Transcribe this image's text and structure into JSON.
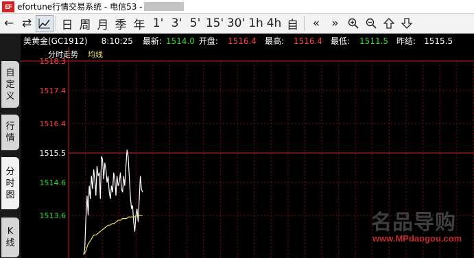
{
  "titlebar": {
    "logo_text": "EF",
    "title": "efortune行情交易系统 - 电信53 - "
  },
  "toolbar": {
    "buttons": [
      {
        "name": "back-arrow-icon",
        "glyph": "←"
      },
      {
        "name": "kline-toggle-icon",
        "glyph": "⇄"
      },
      {
        "name": "line-chart-icon",
        "glyph": "",
        "active": true
      },
      {
        "name": "period-day",
        "glyph": "日"
      },
      {
        "name": "period-week",
        "glyph": "周"
      },
      {
        "name": "period-month",
        "glyph": "月"
      },
      {
        "name": "period-season",
        "glyph": "季"
      },
      {
        "name": "period-year",
        "glyph": "年"
      },
      {
        "name": "period-1min",
        "glyph": "1'"
      },
      {
        "name": "period-3min",
        "glyph": "3'"
      },
      {
        "name": "period-5min",
        "glyph": "5'"
      },
      {
        "name": "period-15min",
        "glyph": "15'"
      },
      {
        "name": "period-30min",
        "glyph": "30'"
      },
      {
        "name": "period-1h",
        "glyph": "1h"
      },
      {
        "name": "period-4h",
        "glyph": "4h"
      },
      {
        "name": "period-custom",
        "glyph": "自"
      },
      {
        "name": "double-left-icon",
        "glyph": "«"
      },
      {
        "name": "double-right-icon",
        "glyph": "»"
      },
      {
        "name": "zoom-in-icon",
        "glyph": ""
      },
      {
        "name": "zoom-out-icon",
        "glyph": ""
      },
      {
        "name": "up-house-icon",
        "glyph": ""
      },
      {
        "name": "down-house-icon",
        "glyph": ""
      }
    ]
  },
  "infobar": {
    "symbol": "美黄金(GC1912)",
    "time": "8:10:25",
    "latest_label": "最新:",
    "latest_value": "1514.0",
    "open_label": "开盘:",
    "open_value": "1516.4",
    "high_label": "最高:",
    "high_value": "1516.4",
    "low_label": "最低:",
    "low_value": "1511.5",
    "prev_label": "昨结:",
    "prev_value": "1515.5"
  },
  "tabs": [
    {
      "label": "自定义",
      "chars": [
        "自",
        "定",
        "义"
      ]
    },
    {
      "label": "行情",
      "chars": [
        "行",
        "情"
      ]
    },
    {
      "label": "分时图",
      "chars": [
        "分",
        "时",
        "图"
      ]
    },
    {
      "label": "K线",
      "chars": [
        "K",
        "线"
      ]
    }
  ],
  "chart_data": {
    "type": "line",
    "title": "分时走势",
    "legend": [
      "均线"
    ],
    "ylim": [
      1512.3,
      1518.3
    ],
    "yticks": [
      {
        "value": 1518.3,
        "label": "1518.3",
        "color": "#ff4040"
      },
      {
        "value": 1517.4,
        "label": "1517.4",
        "color": "#ff4040"
      },
      {
        "value": 1516.4,
        "label": "1516.4",
        "color": "#ff4040"
      },
      {
        "value": 1515.5,
        "label": "1515.5",
        "color": "#ffffff"
      },
      {
        "value": 1514.6,
        "label": "1514.6",
        "color": "#31d931"
      },
      {
        "value": 1513.6,
        "label": "1513.6",
        "color": "#31d931"
      }
    ],
    "reference_value": 1515.5,
    "series": [
      {
        "name": "",
        "color": "#ffffff",
        "y": [
          1512.4,
          1512.6,
          1513.5,
          1514.2,
          1513.6,
          1514.5,
          1514.1,
          1514.8,
          1514.4,
          1515.0,
          1514.7,
          1514.2,
          1515.1,
          1514.8,
          1514.9,
          1514.1,
          1515.4,
          1515.3,
          1514.7,
          1515.2,
          1515.0,
          1514.6,
          1514.8,
          1514.3,
          1514.1,
          1514.5,
          1514.3,
          1514.9,
          1514.7,
          1514.2,
          1514.8,
          1514.5,
          1514.6,
          1514.9,
          1514.4,
          1514.3,
          1514.8,
          1514.5,
          1515.1,
          1515.6,
          1515.4,
          1514.8,
          1514.2,
          1513.8,
          1513.9,
          1513.4,
          1513.1,
          1513.6,
          1513.8,
          1513.4,
          1514.1,
          1514.8,
          1514.4,
          1514.3
        ]
      },
      {
        "name": "均线",
        "color": "#f0e060",
        "y": [
          1512.4,
          1512.5,
          1512.7,
          1512.8,
          1512.9,
          1513.0,
          1513.0,
          1513.05,
          1513.1,
          1513.15,
          1513.2,
          1513.25,
          1513.3,
          1513.3,
          1513.35,
          1513.35,
          1513.4,
          1513.45,
          1513.45,
          1513.5,
          1513.5,
          1513.5,
          1513.55,
          1513.55,
          1513.55,
          1513.55,
          1513.58,
          1513.6,
          1513.6,
          1513.6
        ]
      }
    ],
    "grid_color": "#7a1010",
    "reference_color": "#c42020"
  },
  "watermark": {
    "text": "名品导购",
    "url": "www.MPdaogou.com"
  }
}
